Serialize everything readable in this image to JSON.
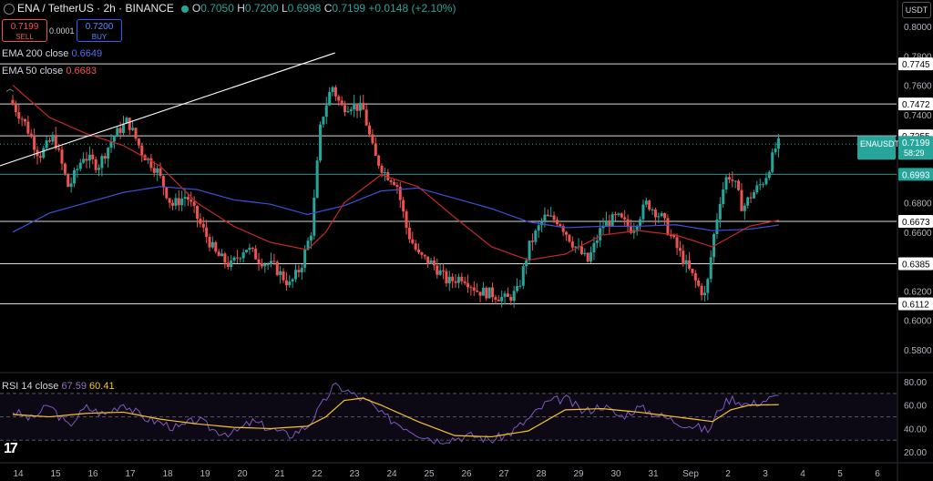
{
  "header": {
    "symbol": "ENA / TetherUS · 2h · BINANCE",
    "open_label": "O",
    "open": "0.7050",
    "high_label": "H",
    "high": "0.7200",
    "low_label": "L",
    "low": "0.6998",
    "close_label": "C",
    "close": "0.7199",
    "change": "+0.0148 (+2.10%)"
  },
  "trade": {
    "sell_price": "0.7199",
    "sell_label": "SELL",
    "spread": "0.0001",
    "buy_price": "0.7200",
    "buy_label": "BUY"
  },
  "currency_button": "USDT",
  "indicators": {
    "ema200_label": "EMA 200 close",
    "ema200_value": "0.6649",
    "ema50_label": "EMA 50 close",
    "ema50_value": "0.6683",
    "rsi_label": "RSI 14 close",
    "rsi_value": "67.59",
    "rsi_ma_value": "60.41"
  },
  "colors": {
    "up": "#26a69a",
    "down": "#ef5350",
    "ema200": "#3f51d8",
    "ema50": "#c62828",
    "rsi": "#7e57c2",
    "rsi_ma": "#f7c325",
    "trendline": "#ffffff",
    "hline": "#ffffff",
    "last_price_tag": "#26a69a"
  },
  "chart_data": {
    "type": "candlestick",
    "title": "ENA / TetherUS · 2h · BINANCE",
    "x_ticks": [
      "14",
      "15",
      "16",
      "17",
      "18",
      "19",
      "20",
      "21",
      "22",
      "23",
      "24",
      "25",
      "26",
      "27",
      "28",
      "29",
      "30",
      "31",
      "Sep",
      "2",
      "3",
      "4",
      "5",
      "6"
    ],
    "y_ticks": [
      "0.8000",
      "0.7800",
      "0.7600",
      "0.7400",
      "0.6800",
      "0.6600",
      "0.6200",
      "0.6000",
      "0.5800"
    ],
    "ylim": [
      0.565,
      0.818
    ],
    "horizontal_levels": [
      "0.7745",
      "0.7472",
      "0.7255",
      "0.6993",
      "0.6673",
      "0.6385",
      "0.6112"
    ],
    "last_price_tag": {
      "label": "ENAUSDT",
      "price": "0.7199",
      "countdown": "58:29"
    },
    "trendline": {
      "from": {
        "x": "22.75",
        "y": 0.782
      },
      "to": {
        "x": "4.75",
        "y": 0.63
      }
    },
    "anchors": [
      [
        "14.0",
        0.75
      ],
      [
        "14.4",
        0.735
      ],
      [
        "14.8",
        0.712
      ],
      [
        "15.2",
        0.725
      ],
      [
        "15.6",
        0.69
      ],
      [
        "16.0",
        0.712
      ],
      [
        "16.4",
        0.705
      ],
      [
        "16.8",
        0.724
      ],
      [
        "17.2",
        0.736
      ],
      [
        "17.6",
        0.714
      ],
      [
        "18.0",
        0.702
      ],
      [
        "18.4",
        0.678
      ],
      [
        "18.8",
        0.685
      ],
      [
        "19.2",
        0.664
      ],
      [
        "19.6",
        0.645
      ],
      [
        "20.0",
        0.637
      ],
      [
        "20.4",
        0.65
      ],
      [
        "20.8",
        0.641
      ],
      [
        "21.2",
        0.636
      ],
      [
        "21.6",
        0.624
      ],
      [
        "21.9",
        0.636
      ],
      [
        "22.2",
        0.662
      ],
      [
        "22.45",
        0.735
      ],
      [
        "22.75",
        0.76
      ],
      [
        "23.0",
        0.745
      ],
      [
        "23.3",
        0.747
      ],
      [
        "23.6",
        0.743
      ],
      [
        "23.9",
        0.712
      ],
      [
        "24.2",
        0.7
      ],
      [
        "24.5",
        0.694
      ],
      [
        "24.8",
        0.66
      ],
      [
        "25.1",
        0.644
      ],
      [
        "25.5",
        0.638
      ],
      [
        "25.9",
        0.626
      ],
      [
        "26.3",
        0.63
      ],
      [
        "26.7",
        0.62
      ],
      [
        "27.1",
        0.618
      ],
      [
        "27.5",
        0.614
      ],
      [
        "27.8",
        0.62
      ],
      [
        "28.1",
        0.65
      ],
      [
        "28.5",
        0.67
      ],
      [
        "28.9",
        0.668
      ],
      [
        "29.3",
        0.652
      ],
      [
        "29.7",
        0.64
      ],
      [
        "30.1",
        0.665
      ],
      [
        "30.5",
        0.67
      ],
      [
        "30.9",
        0.662
      ],
      [
        "31.3",
        0.68
      ],
      [
        "31.7",
        0.67
      ],
      [
        "32.1",
        0.65
      ],
      [
        "32.4",
        0.636
      ],
      [
        "32.7",
        0.623
      ],
      [
        "32.9",
        0.616
      ],
      [
        "33.1",
        0.655
      ],
      [
        "33.3",
        0.684
      ],
      [
        "33.5",
        0.7
      ],
      [
        "33.7",
        0.692
      ],
      [
        "33.9",
        0.676
      ],
      [
        "34.1",
        0.684
      ],
      [
        "34.3",
        0.69
      ],
      [
        "34.5",
        0.696
      ],
      [
        "34.7",
        0.71
      ],
      [
        "34.83",
        0.72
      ]
    ],
    "ema50_anchors": [
      [
        "14.0",
        0.76
      ],
      [
        "15.0",
        0.738
      ],
      [
        "16.0",
        0.727
      ],
      [
        "17.0",
        0.719
      ],
      [
        "18.0",
        0.705
      ],
      [
        "19.0",
        0.68
      ],
      [
        "20.0",
        0.664
      ],
      [
        "21.0",
        0.653
      ],
      [
        "22.0",
        0.648
      ],
      [
        "22.5",
        0.66
      ],
      [
        "23.0",
        0.68
      ],
      [
        "24.0",
        0.699
      ],
      [
        "25.0",
        0.691
      ],
      [
        "26.0",
        0.67
      ],
      [
        "27.0",
        0.65
      ],
      [
        "28.0",
        0.641
      ],
      [
        "29.0",
        0.645
      ],
      [
        "30.0",
        0.658
      ],
      [
        "31.0",
        0.661
      ],
      [
        "32.0",
        0.658
      ],
      [
        "33.0",
        0.65
      ],
      [
        "34.0",
        0.664
      ],
      [
        "34.83",
        0.6683
      ]
    ],
    "ema200_anchors": [
      [
        "14.0",
        0.66
      ],
      [
        "15.0",
        0.673
      ],
      [
        "16.0",
        0.68
      ],
      [
        "17.0",
        0.687
      ],
      [
        "18.0",
        0.691
      ],
      [
        "19.0",
        0.689
      ],
      [
        "20.0",
        0.682
      ],
      [
        "21.0",
        0.679
      ],
      [
        "22.0",
        0.672
      ],
      [
        "23.0",
        0.678
      ],
      [
        "24.0",
        0.688
      ],
      [
        "25.0",
        0.69
      ],
      [
        "26.0",
        0.683
      ],
      [
        "27.0",
        0.676
      ],
      [
        "28.0",
        0.667
      ],
      [
        "29.0",
        0.663
      ],
      [
        "30.0",
        0.664
      ],
      [
        "31.0",
        0.664
      ],
      [
        "32.0",
        0.665
      ],
      [
        "33.0",
        0.661
      ],
      [
        "34.0",
        0.662
      ],
      [
        "34.83",
        0.6649
      ]
    ],
    "rsi": {
      "ylim": [
        17,
        87
      ],
      "y_ticks": [
        "80.00",
        "60.00",
        "40.00",
        "20.00"
      ],
      "bands": [
        70,
        50,
        30
      ],
      "anchors": [
        [
          "14.0",
          55
        ],
        [
          "14.5",
          48
        ],
        [
          "15.0",
          60
        ],
        [
          "15.5",
          42
        ],
        [
          "16.0",
          58
        ],
        [
          "16.5",
          52
        ],
        [
          "17.0",
          62
        ],
        [
          "17.5",
          50
        ],
        [
          "18.0",
          45
        ],
        [
          "18.5",
          40
        ],
        [
          "19.0",
          48
        ],
        [
          "19.5",
          38
        ],
        [
          "20.0",
          36
        ],
        [
          "20.5",
          46
        ],
        [
          "21.0",
          40
        ],
        [
          "21.5",
          34
        ],
        [
          "22.0",
          42
        ],
        [
          "22.4",
          60
        ],
        [
          "22.7",
          76
        ],
        [
          "23.0",
          74
        ],
        [
          "23.3",
          68
        ],
        [
          "23.7",
          62
        ],
        [
          "24.0",
          52
        ],
        [
          "24.5",
          44
        ],
        [
          "25.0",
          36
        ],
        [
          "25.5",
          30
        ],
        [
          "26.0",
          32
        ],
        [
          "26.5",
          34
        ],
        [
          "27.0",
          30
        ],
        [
          "27.5",
          36
        ],
        [
          "28.0",
          48
        ],
        [
          "28.5",
          62
        ],
        [
          "29.0",
          66
        ],
        [
          "29.5",
          54
        ],
        [
          "30.0",
          60
        ],
        [
          "30.5",
          50
        ],
        [
          "31.0",
          58
        ],
        [
          "31.5",
          52
        ],
        [
          "32.0",
          46
        ],
        [
          "32.5",
          42
        ],
        [
          "32.9",
          38
        ],
        [
          "33.2",
          58
        ],
        [
          "33.5",
          66
        ],
        [
          "34.0",
          60
        ],
        [
          "34.4",
          64
        ],
        [
          "34.83",
          67.59
        ]
      ],
      "ma_anchors": [
        [
          "14.0",
          52
        ],
        [
          "15.0",
          50
        ],
        [
          "16.0",
          53
        ],
        [
          "17.0",
          54
        ],
        [
          "18.0",
          48
        ],
        [
          "19.0",
          44
        ],
        [
          "20.0",
          41
        ],
        [
          "21.0",
          40
        ],
        [
          "22.0",
          42
        ],
        [
          "22.5",
          50
        ],
        [
          "23.0",
          64
        ],
        [
          "23.5",
          66
        ],
        [
          "24.0",
          60
        ],
        [
          "25.0",
          46
        ],
        [
          "26.0",
          34
        ],
        [
          "27.0",
          33
        ],
        [
          "28.0",
          38
        ],
        [
          "29.0",
          56
        ],
        [
          "30.0",
          57
        ],
        [
          "31.0",
          54
        ],
        [
          "32.0",
          50
        ],
        [
          "33.0",
          46
        ],
        [
          "33.5",
          56
        ],
        [
          "34.0",
          60
        ],
        [
          "34.83",
          60.41
        ]
      ]
    }
  }
}
